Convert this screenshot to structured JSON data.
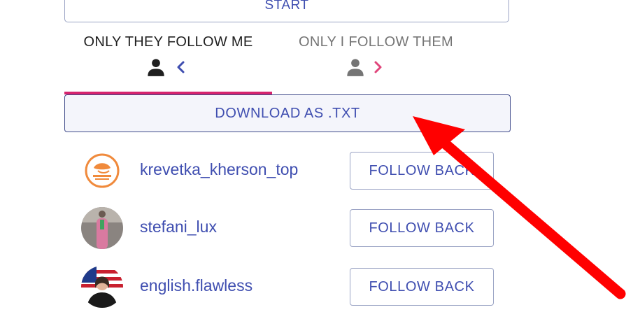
{
  "start_button": {
    "label": "START"
  },
  "tabs": [
    {
      "label": "ONLY THEY FOLLOW ME",
      "icon": "person-icon",
      "chevron": "chevron-left-icon",
      "chevron_color": "#3f4eb0",
      "active": true
    },
    {
      "label": "ONLY I FOLLOW THEM",
      "icon": "person-icon",
      "chevron": "chevron-right-icon",
      "chevron_color": "#e0457b",
      "active": false
    }
  ],
  "download_button": {
    "label": "DOWNLOAD AS .TXT"
  },
  "users": [
    {
      "username": "krevetka_kherson_top",
      "action": "FOLLOW BACK"
    },
    {
      "username": "stefani_lux",
      "action": "FOLLOW BACK"
    },
    {
      "username": "english.flawless",
      "action": "FOLLOW BACK"
    }
  ],
  "colors": {
    "accent": "#3f4eb0",
    "tab_indicator": "#d6246e",
    "annotation_arrow": "#ff0000"
  }
}
